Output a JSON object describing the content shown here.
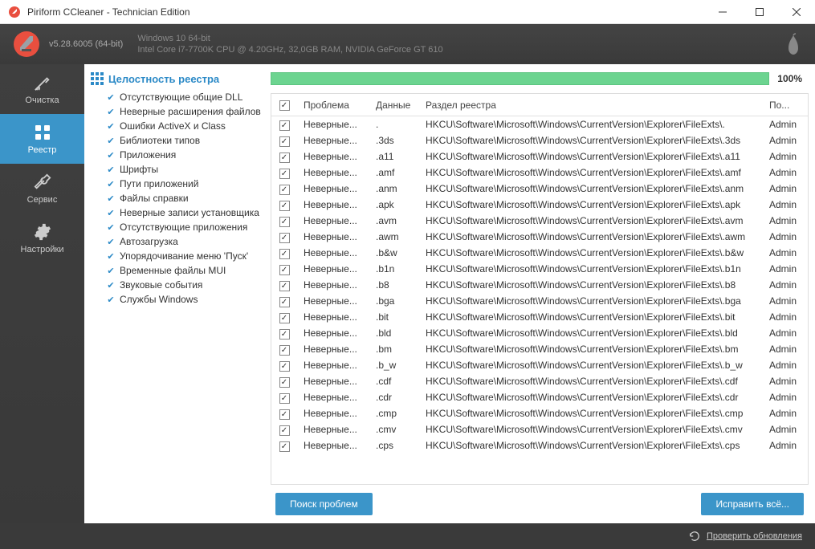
{
  "titlebar": {
    "text": "Piriform CCleaner - Technician Edition"
  },
  "header": {
    "version": "v5.28.6005 (64-bit)",
    "sys_line1": "Windows 10 64-bit",
    "sys_line2": "Intel Core i7-7700K CPU @ 4.20GHz, 32,0GB RAM, NVIDIA GeForce GT 610"
  },
  "sidebar": {
    "items": [
      {
        "label": "Очистка"
      },
      {
        "label": "Реестр"
      },
      {
        "label": "Сервис"
      },
      {
        "label": "Настройки"
      }
    ]
  },
  "options": {
    "title": "Целостность реестра",
    "items": [
      "Отсутствующие общие DLL",
      "Неверные расширения файлов",
      "Ошибки ActiveX и Class",
      "Библиотеки типов",
      "Приложения",
      "Шрифты",
      "Пути приложений",
      "Файлы справки",
      "Неверные записи установщика",
      "Отсутствующие приложения",
      "Автозагрузка",
      "Упорядочивание меню 'Пуск'",
      "Временные файлы MUI",
      "Звуковые события",
      "Службы Windows"
    ]
  },
  "results": {
    "progress_label": "100%",
    "headers": {
      "problem": "Проблема",
      "data": "Данные",
      "registry": "Раздел реестра",
      "user": "По..."
    },
    "problem_text": "Неверные...",
    "user_text": "Admin",
    "reg_prefix": "HKCU\\Software\\Microsoft\\Windows\\CurrentVersion\\Explorer\\FileExts\\",
    "rows": [
      {
        "data": ".",
        "ext": "."
      },
      {
        "data": ".3ds",
        "ext": ".3ds"
      },
      {
        "data": ".a11",
        "ext": ".a11"
      },
      {
        "data": ".amf",
        "ext": ".amf"
      },
      {
        "data": ".anm",
        "ext": ".anm"
      },
      {
        "data": ".apk",
        "ext": ".apk"
      },
      {
        "data": ".avm",
        "ext": ".avm"
      },
      {
        "data": ".awm",
        "ext": ".awm"
      },
      {
        "data": ".b&w",
        "ext": ".b&w"
      },
      {
        "data": ".b1n",
        "ext": ".b1n"
      },
      {
        "data": ".b8",
        "ext": ".b8"
      },
      {
        "data": ".bga",
        "ext": ".bga"
      },
      {
        "data": ".bit",
        "ext": ".bit"
      },
      {
        "data": ".bld",
        "ext": ".bld"
      },
      {
        "data": ".bm",
        "ext": ".bm"
      },
      {
        "data": ".b_w",
        "ext": ".b_w"
      },
      {
        "data": ".cdf",
        "ext": ".cdf"
      },
      {
        "data": ".cdr",
        "ext": ".cdr"
      },
      {
        "data": ".cmp",
        "ext": ".cmp"
      },
      {
        "data": ".cmv",
        "ext": ".cmv"
      },
      {
        "data": ".cps",
        "ext": ".cps"
      }
    ]
  },
  "buttons": {
    "scan": "Поиск проблем",
    "fix": "Исправить всё..."
  },
  "footer": {
    "update": "Проверить обновления"
  }
}
